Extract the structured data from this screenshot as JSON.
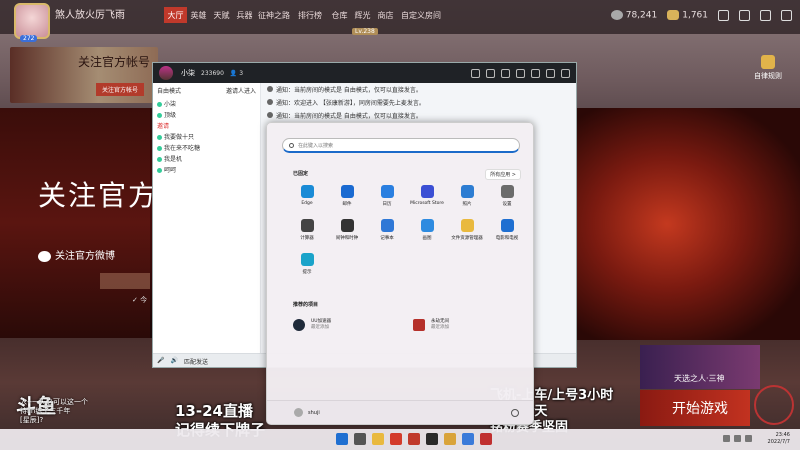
{
  "game": {
    "name": "煞人放火厉飞雨",
    "level_badge": "272",
    "nav": [
      "大厅",
      "英雄",
      "天赋",
      "兵器",
      "征神之路",
      "排行榜",
      "仓库",
      "辉光",
      "商店",
      "自定义房间"
    ],
    "active_nav": "大厅",
    "level": "Lv.238",
    "coins_silver": "78,241",
    "coins_gold": "1,761",
    "promo_title": "关注官方帐号",
    "promo_button": "关注官方帐号",
    "follow_big": "关注官方",
    "weibo_label": "关注官方微博",
    "rules_label": "自律规则",
    "hero_card": "天选之人·三神",
    "start_game": "开始游戏"
  },
  "overlay": {
    "douyu_logo": "斗鱼",
    "chat_lines": [
      "人--一天之可以这一个",
      "待lin练了三千年",
      "[星辰]?"
    ],
    "live_line1": "13-24直播",
    "live_line2": "记得续下牌子",
    "fly_line1": "飞机-上车/上号3小时",
    "fly_line2": "铭粉-全天",
    "fly_line3": "铭粉赛季坚固"
  },
  "qq": {
    "user": "小柒",
    "id": "233690",
    "members": "3",
    "side_head_left": "自由模式",
    "side_head_right": "邀请人进入",
    "side_rows": [
      {
        "text": "小柒",
        "color": "normal"
      },
      {
        "text": "顶级",
        "color": "normal"
      },
      {
        "text": "邀请",
        "color": "red"
      },
      {
        "text": "我要做十只",
        "color": "normal"
      },
      {
        "text": "我在来不吃糖",
        "color": "normal"
      },
      {
        "text": "我是机",
        "color": "normal"
      },
      {
        "text": "呵呵",
        "color": "normal"
      }
    ],
    "notices": [
      "通知：当前房间的模式是 自由模式，仅可以直接发言。",
      "通知：欢迎进入 【张康新游】，同房间需要先上麦发言。",
      "通知：当前房间的模式是 自由模式，仅可以直接发言。"
    ],
    "bottom_label": "匹配发送"
  },
  "start_menu": {
    "search_placeholder": "在此键入以搜索",
    "pinned_title": "已固定",
    "all_apps": "所有应用  >",
    "apps": [
      {
        "label": "Edge",
        "icon": "edge-icon",
        "color": "#1a8bd6"
      },
      {
        "label": "邮件",
        "icon": "mail-icon",
        "color": "#1a6ad1"
      },
      {
        "label": "日历",
        "icon": "calendar-icon",
        "color": "#2a7fe0"
      },
      {
        "label": "Microsoft Store",
        "icon": "store-icon",
        "color": "#3b4fd4"
      },
      {
        "label": "照片",
        "icon": "photos-icon",
        "color": "#2d7dd2"
      },
      {
        "label": "设置",
        "icon": "settings-icon",
        "color": "#6b6b6b"
      },
      {
        "label": "计算器",
        "icon": "calculator-icon",
        "color": "#444444"
      },
      {
        "label": "闹钟和时钟",
        "icon": "clock-icon",
        "color": "#333333"
      },
      {
        "label": "记事本",
        "icon": "notepad-icon",
        "color": "#2f78d6"
      },
      {
        "label": "画图",
        "icon": "paint-icon",
        "color": "#2e8be0"
      },
      {
        "label": "文件资源管理器",
        "icon": "folder-icon",
        "color": "#e9b93e"
      },
      {
        "label": "电影和电视",
        "icon": "movies-icon",
        "color": "#1f6fd1"
      },
      {
        "label": "提示",
        "icon": "tips-icon",
        "color": "#1aa3c9"
      }
    ],
    "recommended_title": "推荐的项目",
    "recommended": [
      {
        "title": "UU加速器",
        "sub": "最近添加",
        "icon": "uu-icon",
        "color": "#1f2a3a"
      },
      {
        "title": "永劫无间",
        "sub": "最近添加",
        "icon": "game-icon",
        "color": "#b5302a"
      }
    ],
    "user": "shuji"
  },
  "taskbar": {
    "time": "23:46",
    "date": "2022/7/7",
    "items": [
      "#1f6fd1",
      "#555555",
      "#e9b93e",
      "#d33a2a",
      "#c0392b",
      "#2a2a2a",
      "#d9a33a",
      "#3a7ad9",
      "#c03030"
    ]
  }
}
